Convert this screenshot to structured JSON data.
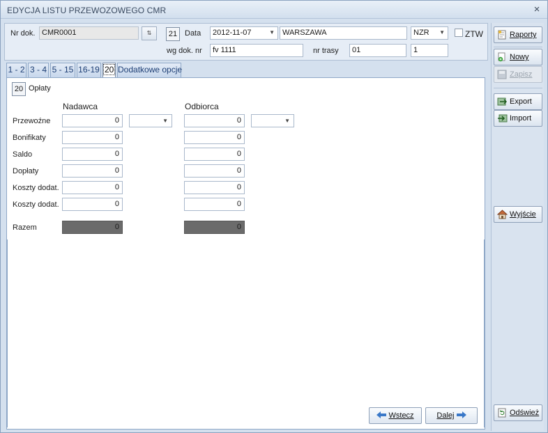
{
  "window": {
    "title": "EDYCJA LISTU PRZEWOZOWEGO CMR",
    "close_glyph": "×"
  },
  "header": {
    "nr_dok_label": "Nr dok.",
    "nr_dok_value": "CMR0001",
    "picker_glyph": "⇅",
    "number_box": "21",
    "data_label": "Data",
    "data_value": "2012-11-07",
    "city_value": "WARSZAWA",
    "code_value": "NZR",
    "ztw_label": "ZTW",
    "wg_dok_label": "wg dok. nr",
    "wg_dok_value": "fv 1111",
    "nr_trasy_label": "nr trasy",
    "nr_trasy_value": "01",
    "extra_value": "1"
  },
  "tabs": [
    {
      "label": "1 - 2"
    },
    {
      "label": "3 - 4"
    },
    {
      "label": "5 - 15"
    },
    {
      "label": "16-19"
    },
    {
      "label": "20"
    },
    {
      "label": "Dodatkowe opcje"
    }
  ],
  "section": {
    "number": "20",
    "title": "Opłaty"
  },
  "columns": {
    "sender": "Nadawca",
    "receiver": "Odbiorca"
  },
  "rows": [
    {
      "label": "Przewoźne",
      "sender": "0",
      "receiver": "0"
    },
    {
      "label": "Bonifikaty",
      "sender": "0",
      "receiver": "0"
    },
    {
      "label": "Saldo",
      "sender": "0",
      "receiver": "0"
    },
    {
      "label": "Dopłaty",
      "sender": "0",
      "receiver": "0"
    },
    {
      "label": "Koszty dodat.",
      "sender": "0",
      "receiver": "0"
    },
    {
      "label": "Koszty dodat.",
      "sender": "0",
      "receiver": "0"
    }
  ],
  "total": {
    "label": "Razem",
    "sender": "0",
    "receiver": "0"
  },
  "nav": {
    "back_label": "Wstecz",
    "next_label": "Dalej"
  },
  "sidebar": {
    "raporty": "Raporty",
    "nowy": "Nowy",
    "zapisz": "Zapisz",
    "export": "Export",
    "import": "Import",
    "wyjscie": "Wyjście",
    "odswiez": "Odśwież"
  },
  "colors": {
    "accent": "#1d3e74",
    "panel": "#d4e0ee",
    "total_fill": "#6b6b6b"
  }
}
